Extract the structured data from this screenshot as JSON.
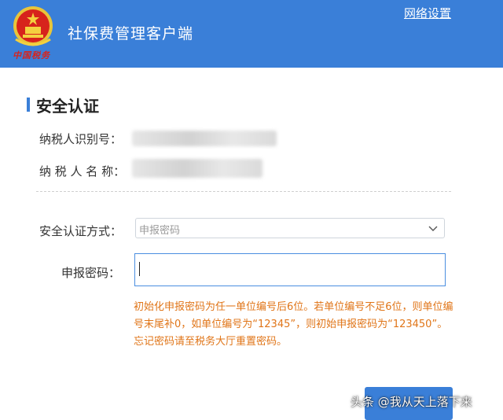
{
  "header": {
    "app_title": "社保费管理客户端",
    "emblem_text": "中国税务",
    "network_settings": "网络设置"
  },
  "section": {
    "title": "安全认证"
  },
  "taxpayer": {
    "id_label": "纳税人识别号：",
    "name_label": "纳 税 人 名 称："
  },
  "auth": {
    "method_label": "安全认证方式：",
    "method_placeholder": "申报密码",
    "password_label": "申报密码：",
    "password_value": "",
    "hint": "初始化申报密码为任一单位编号后6位。若单位编号不足6位，则单位编号末尾补0，如单位编号为“12345”，则初始申报密码为“123450”。忘记密码请至税务大厅重置密码。"
  },
  "watermark": {
    "text": "头条 @我从天上落下来"
  },
  "colors": {
    "header_blue": "#3a7fd8",
    "hint_orange": "#e07518"
  }
}
